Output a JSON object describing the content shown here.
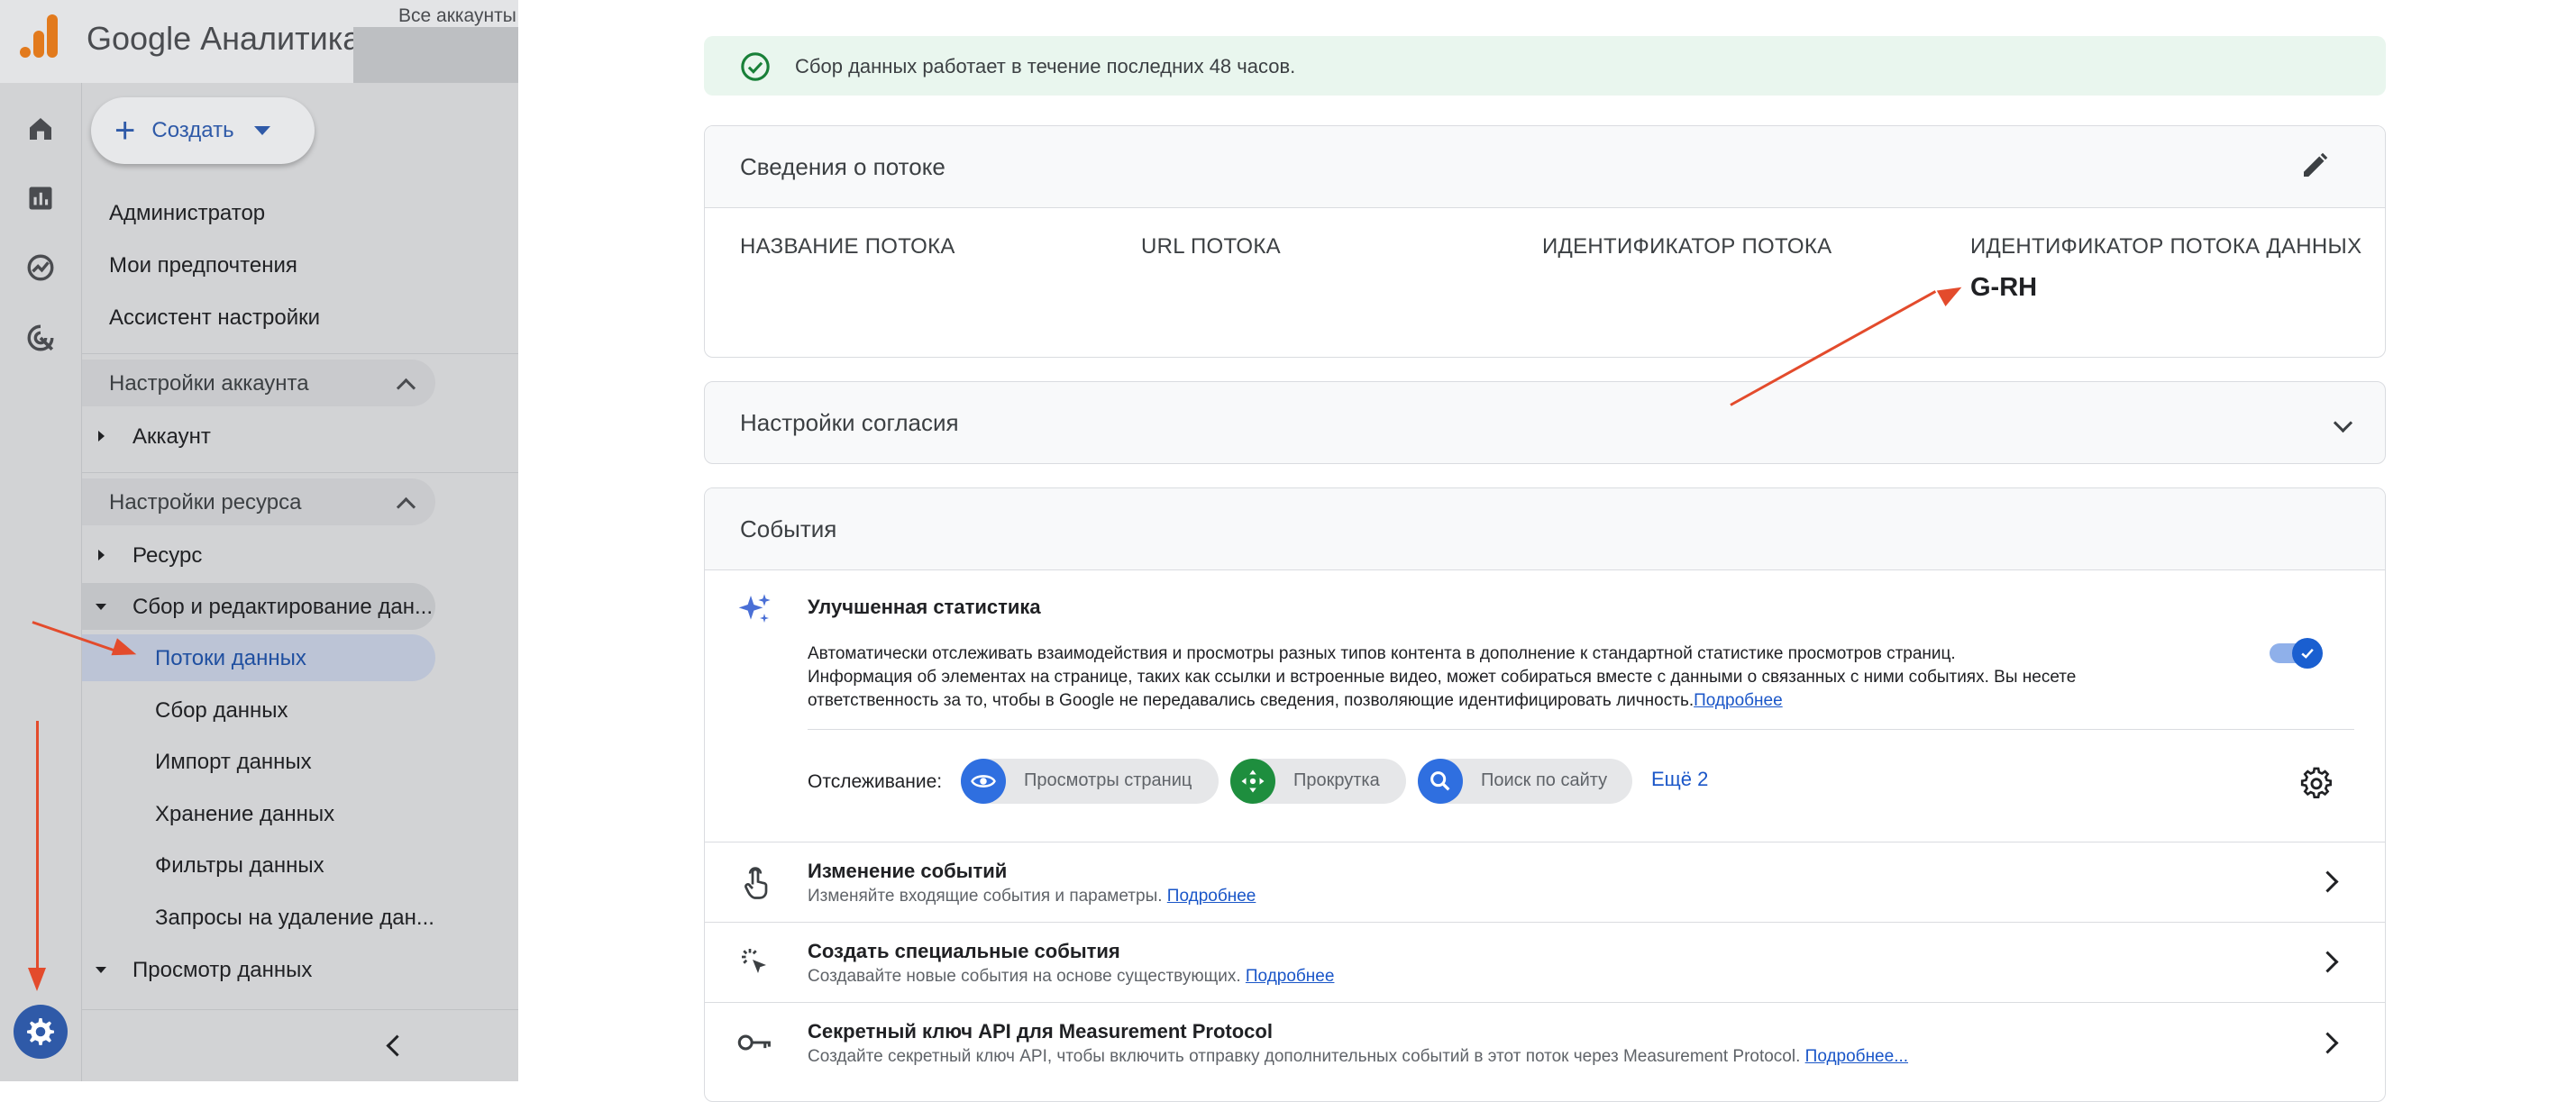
{
  "header": {
    "brand": "Google Аналитика",
    "breadcrumb": "Все аккаунты"
  },
  "nav": {
    "create_label": "Создать",
    "top_items": [
      "Администратор",
      "Мои предпочтения",
      "Ассистент настройки"
    ],
    "account_settings": {
      "title": "Настройки аккаунта",
      "items": [
        "Аккаунт"
      ]
    },
    "resource_settings": {
      "title": "Настройки ресурса",
      "resource": "Ресурс",
      "data_collection": "Сбор и редактирование дан...",
      "sub_items": [
        "Потоки данных",
        "Сбор данных",
        "Импорт данных",
        "Хранение данных",
        "Фильтры данных",
        "Запросы на удаление дан..."
      ],
      "selected": "Потоки данных",
      "data_view": "Просмотр данных"
    }
  },
  "main": {
    "banner": "Сбор данных работает в течение последних 48 часов.",
    "stream_details": {
      "title": "Сведения о потоке",
      "columns": [
        {
          "label": "НАЗВАНИЕ ПОТОКА",
          "value": ""
        },
        {
          "label": "URL ПОТОКА",
          "value": ""
        },
        {
          "label": "ИДЕНТИФИКАТОР ПОТОКА",
          "value": ""
        },
        {
          "label": "ИДЕНТИФИКАТОР ПОТОКА ДАННЫХ",
          "value": "G-RH"
        }
      ]
    },
    "consent": {
      "title": "Настройки согласия"
    },
    "events": {
      "title": "События",
      "enhanced": {
        "title": "Улучшенная статистика",
        "line1": "Автоматически отслеживать взаимодействия и просмотры разных типов контента в дополнение к стандартной статистике просмотров страниц.",
        "line2": "Информация об элементах на странице, таких как ссылки и встроенные видео, может собираться вместе с данными о связанных с ними событиях. Вы несете",
        "line3": "ответственность за то, чтобы в Google не передавались сведения, позволяющие идентифицировать личность.",
        "more": "Подробнее",
        "toggle_on": true,
        "tracking_label": "Отслеживание:",
        "chips": [
          "Просмотры страниц",
          "Прокрутка",
          "Поиск по сайту"
        ],
        "more_count": "Ещё 2"
      },
      "rows": [
        {
          "title": "Изменение событий",
          "desc": "Изменяйте входящие события и параметры.",
          "more": "Подробнее"
        },
        {
          "title": "Создать специальные события",
          "desc": "Создавайте новые события на основе существующих.",
          "more": "Подробнее"
        },
        {
          "title": "Секретный ключ API для Measurement Protocol",
          "desc": "Создайте секретный ключ API, чтобы включить отправку дополнительных событий в этот поток через Measurement Protocol.",
          "more": "Подробнее..."
        }
      ]
    }
  },
  "colors": {
    "accent": "#1a73e8",
    "annotation_arrow": "#e34b2c",
    "banner_bg": "#e9f6ee",
    "success": "#188038"
  }
}
